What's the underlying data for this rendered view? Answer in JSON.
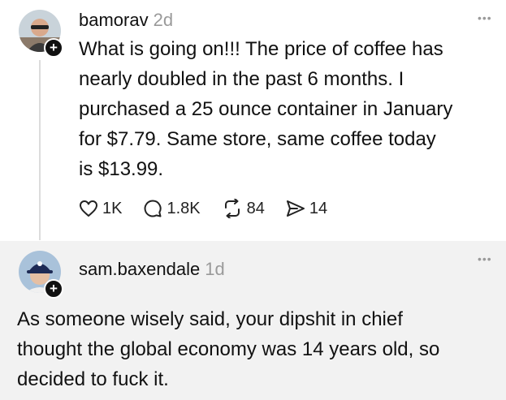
{
  "post": {
    "username": "bamorav",
    "time": "2d",
    "more": "•••",
    "body": "What is going on!!! The price of coffee has\nnearly doubled in the past 6 months.  I\npurchased a 25 ounce container in January\nfor $7.79.  Same store, same coffee today\nis $13.99.",
    "actions": {
      "likes": "1K",
      "replies": "1.8K",
      "reposts": "84",
      "shares": "14"
    }
  },
  "reply": {
    "username": "sam.baxendale",
    "time": "1d",
    "more": "•••",
    "body": "As someone wisely said, your dipshit in chief\nthought the global economy was 14 years old, so\ndecided to fuck it."
  },
  "icons": {
    "like": "heart-icon",
    "reply": "speech-bubble-icon",
    "repost": "repost-icon",
    "share": "send-icon",
    "follow": "plus-icon"
  }
}
